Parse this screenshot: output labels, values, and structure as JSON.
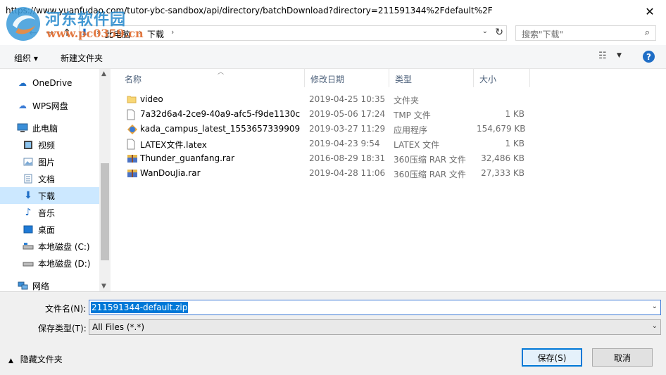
{
  "window": {
    "title": "https://www.yuanfudao.com/tutor-ybc-sandbox/api/directory/batchDownload?directory=211591344%2Fdefault%2F",
    "close_glyph": "✕"
  },
  "watermark": {
    "text_cn": "河东软件园",
    "text_url": "www.pc0359.cn"
  },
  "address": {
    "crumbs": [
      "此电脑",
      "下载"
    ],
    "search_placeholder": "搜索\"下载\""
  },
  "toolbar": {
    "organize": "组织 ▾",
    "new_folder": "新建文件夹",
    "help": "?"
  },
  "nav": {
    "items": [
      {
        "label": "OneDrive",
        "icon": "cloud-icon"
      },
      {
        "label": "WPS网盘",
        "icon": "wps-cloud-icon"
      },
      {
        "label": "此电脑",
        "icon": "computer-icon"
      },
      {
        "label": "视频",
        "icon": "video-folder-icon"
      },
      {
        "label": "图片",
        "icon": "pictures-folder-icon"
      },
      {
        "label": "文档",
        "icon": "documents-folder-icon"
      },
      {
        "label": "下载",
        "icon": "downloads-folder-icon",
        "selected": true
      },
      {
        "label": "音乐",
        "icon": "music-folder-icon"
      },
      {
        "label": "桌面",
        "icon": "desktop-folder-icon"
      },
      {
        "label": "本地磁盘 (C:)",
        "icon": "drive-c-icon"
      },
      {
        "label": "本地磁盘 (D:)",
        "icon": "drive-d-icon"
      },
      {
        "label": "网络",
        "icon": "network-icon"
      }
    ]
  },
  "columns": {
    "name": "名称",
    "date": "修改日期",
    "type": "类型",
    "size": "大小"
  },
  "files": [
    {
      "name": "video",
      "date": "2019-04-25 10:35",
      "type": "文件夹",
      "size": "",
      "icon": "folder-icon"
    },
    {
      "name": "7a32d6a4-2ce9-40a9-afc5-f9de1130c...",
      "date": "2019-05-06 17:24",
      "type": "TMP 文件",
      "size": "1 KB",
      "icon": "file-icon"
    },
    {
      "name": "kada_campus_latest_1553657339909....",
      "date": "2019-03-27 11:29",
      "type": "应用程序",
      "size": "154,679 KB",
      "icon": "app-icon"
    },
    {
      "name": "LATEX文件.latex",
      "date": "2019-04-23 9:54",
      "type": "LATEX 文件",
      "size": "1 KB",
      "icon": "file-icon"
    },
    {
      "name": "Thunder_guanfang.rar",
      "date": "2016-08-29 18:31",
      "type": "360压缩 RAR 文件",
      "size": "32,486 KB",
      "icon": "rar-icon"
    },
    {
      "name": "WanDouJia.rar",
      "date": "2019-04-28 11:06",
      "type": "360压缩 RAR 文件",
      "size": "27,333 KB",
      "icon": "rar-icon"
    }
  ],
  "form": {
    "filename_label": "文件名(N):",
    "filename_value": "211591344-default.zip",
    "filetype_label": "保存类型(T):",
    "filetype_value": "All Files (*.*)",
    "hide_folders": "隐藏文件夹",
    "save": "保存(S)",
    "cancel": "取消"
  }
}
